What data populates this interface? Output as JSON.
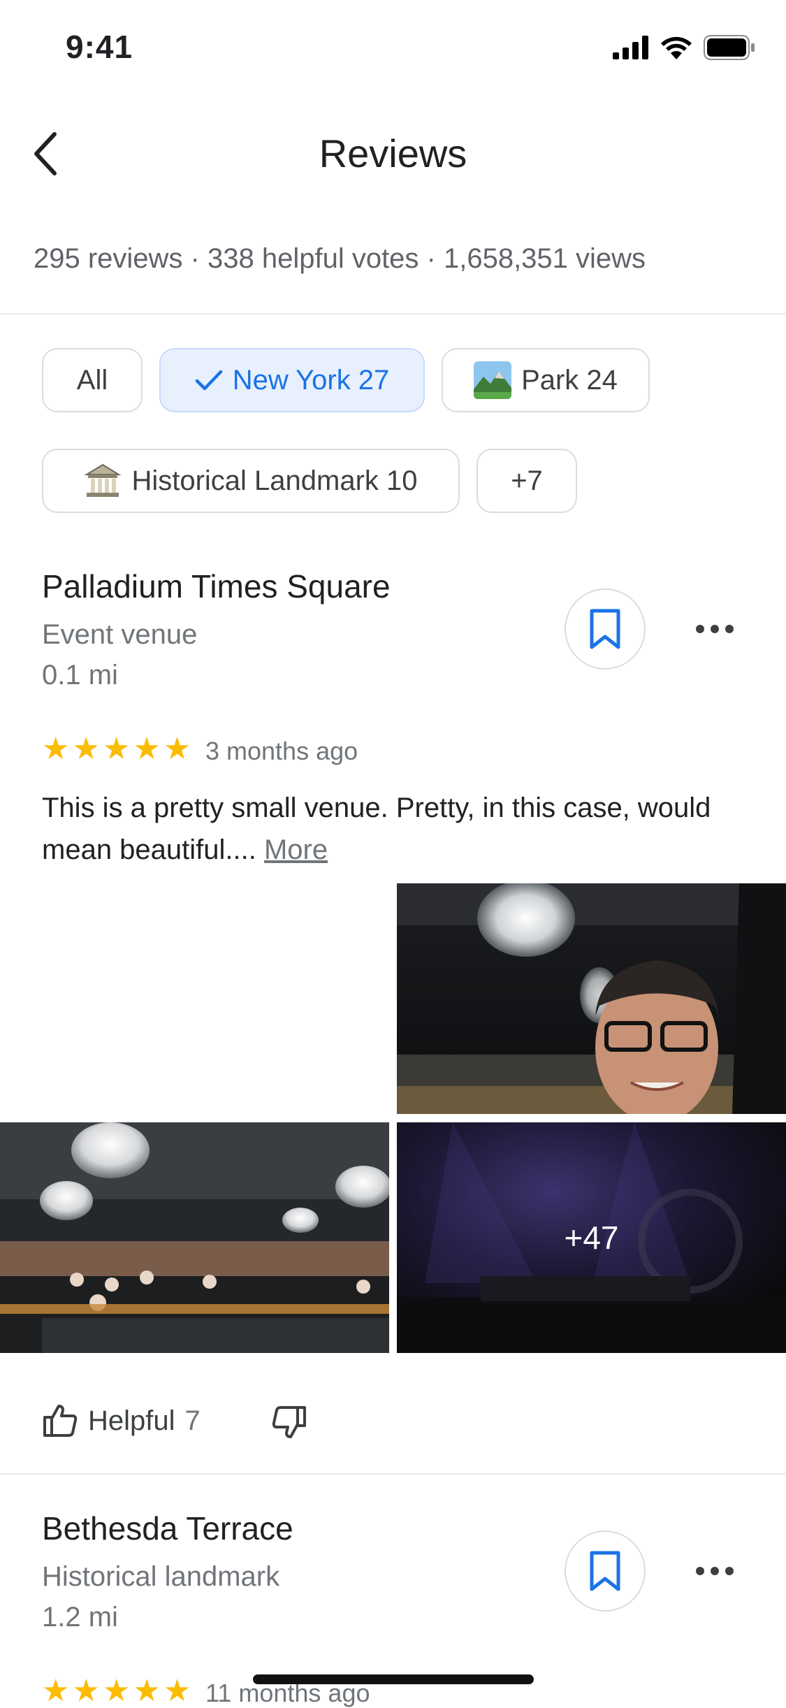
{
  "status_bar": {
    "time": "9:41"
  },
  "header": {
    "title": "Reviews"
  },
  "stats": "295 reviews · 338 helpful votes · 1,658,351 views",
  "filters": [
    {
      "label": "All"
    },
    {
      "label": "New York 27",
      "selected": true
    },
    {
      "label": "Park 24",
      "icon": "park-thumbnail"
    },
    {
      "label": "Historical Landmark 10",
      "icon": "landmark-icon"
    },
    {
      "label": "+7"
    }
  ],
  "reviews": [
    {
      "place": "Palladium Times Square",
      "category": "Event venue",
      "distance": "0.1 mi",
      "rating": 5,
      "date": "3 months ago",
      "text": "This is a pretty small venue. Pretty, in this case, would mean beautiful....",
      "more_label": "More",
      "photos_more": "+47",
      "helpful_label": "Helpful",
      "helpful_count": "7"
    },
    {
      "place": "Bethesda Terrace",
      "category": "Historical landmark",
      "distance": "1.2 mi",
      "rating": 5,
      "date": "11 months ago"
    }
  ],
  "colors": {
    "accent": "#1a73e8",
    "star": "#fbbc04",
    "chip_selected_bg": "#e8f0fe"
  }
}
